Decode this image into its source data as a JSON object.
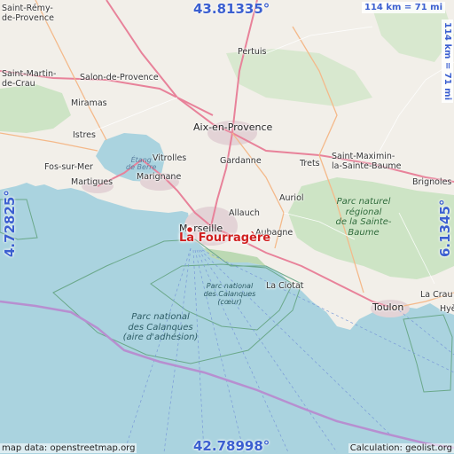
{
  "coordinates": {
    "top": "43.81335°",
    "bottom": "42.78998°",
    "left": "4.72825°",
    "right": "6.1345°"
  },
  "scale": {
    "horizontal": "114 km = 71 mi",
    "vertical": "114 km = 71 mi"
  },
  "place": {
    "name": "La Fourragère"
  },
  "cities": {
    "saint_remy": "Saint-Rémy-\nde-Provence",
    "pertuis": "Pertuis",
    "saint_martin": "Saint-Martin-\nde-Crau",
    "salon": "Salon-de-Provence",
    "miramas": "Miramas",
    "aix": "Aix-en-Provence",
    "istres": "Istres",
    "vitrolles": "Vitrolles",
    "gardanne": "Gardanne",
    "trets": "Trets",
    "saint_maximin": "Saint-Maximin-\nla-Sainte-Baume",
    "fos": "Fos-sur-Mer",
    "martigues": "Martigues",
    "marignane": "Marignane",
    "brignoles": "Brignoles",
    "auriol": "Auriol",
    "allauch": "Allauch",
    "marseille": "Marseille",
    "aubagne": "Aubagne",
    "la_ciotat": "La Ciotat",
    "toulon": "Toulon",
    "la_crau": "La Crau",
    "hyeres": "Hyè"
  },
  "water_labels": {
    "etang": "Étang\nde Berre"
  },
  "parks": {
    "sainte_baume": "Parc naturel\nrégional\nde la Sainte-\nBaume",
    "calanques_coeur": "Parc national\ndes Calanques\n(cœur)",
    "calanques_adhesion": "Parc national\ndes Calanques\n(aire d'adhésion)"
  },
  "attribution": {
    "left": "map data: openstreetmap.org",
    "right": "Calculation: geolist.org"
  },
  "colors": {
    "sea": "#aad3df",
    "land": "#f2efe9",
    "forest": "#cde4c5",
    "urban": "#e3d3d6",
    "motorway": "#e8829a",
    "trunk": "#f4b98a",
    "boundary": "#b78fd0",
    "coord_text": "#3b5fd0",
    "place_text": "#d02020"
  }
}
